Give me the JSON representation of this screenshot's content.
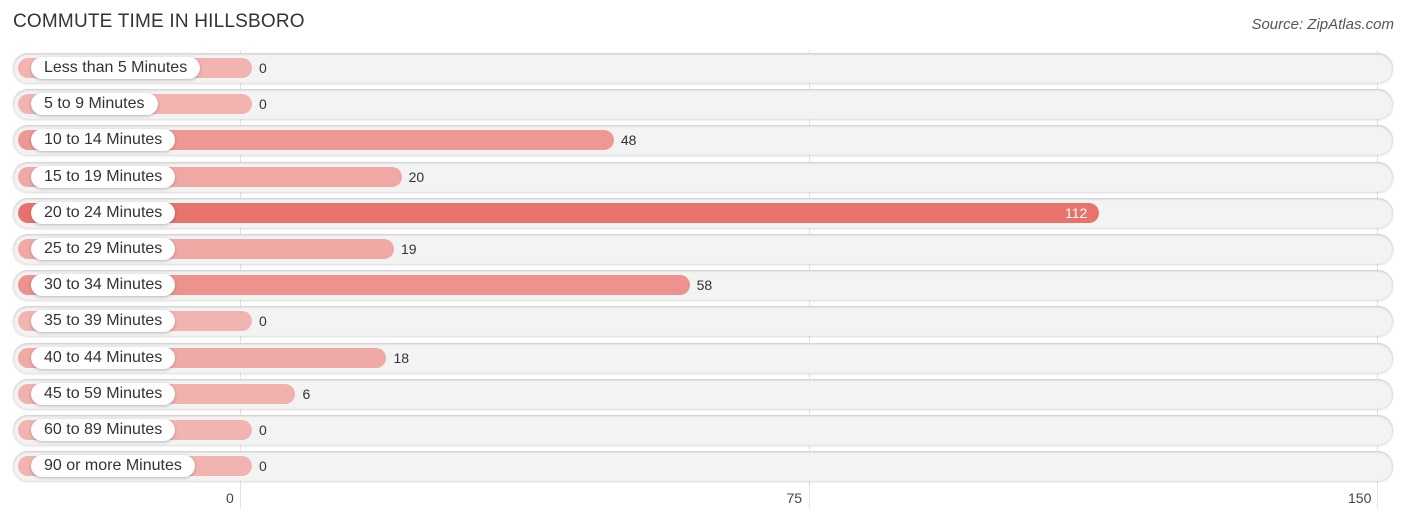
{
  "chart_data": {
    "type": "bar",
    "orientation": "horizontal",
    "title": "COMMUTE TIME IN HILLSBORO",
    "source": "Source: ZipAtlas.com",
    "categories": [
      "Less than 5 Minutes",
      "5 to 9 Minutes",
      "10 to 14 Minutes",
      "15 to 19 Minutes",
      "20 to 24 Minutes",
      "25 to 29 Minutes",
      "30 to 34 Minutes",
      "35 to 39 Minutes",
      "40 to 44 Minutes",
      "45 to 59 Minutes",
      "60 to 89 Minutes",
      "90 or more Minutes"
    ],
    "values": [
      0,
      0,
      48,
      20,
      112,
      19,
      58,
      0,
      18,
      6,
      0,
      0
    ],
    "value_labels": [
      "0",
      "0",
      "48",
      "20",
      "112",
      "19",
      "58",
      "0",
      "18",
      "6",
      "0",
      "0"
    ],
    "xlim": [
      0,
      150
    ],
    "xticks": [
      "0",
      "75",
      "150"
    ],
    "grid": true,
    "colors": {
      "low": "#f2b4b1",
      "high": "#e8736c"
    }
  }
}
